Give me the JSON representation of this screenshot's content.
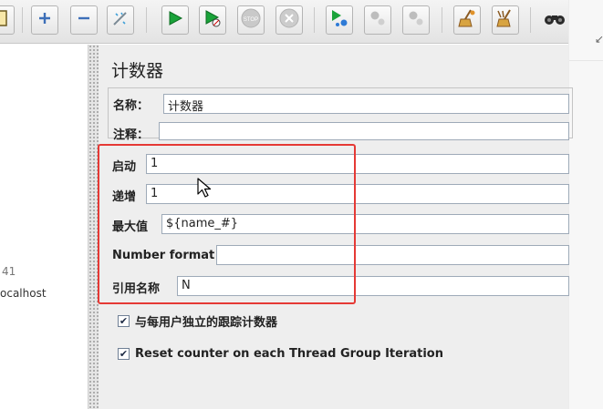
{
  "toolbar": {
    "buttons": [
      {
        "name": "templates-button",
        "icon": "document-icon"
      },
      {
        "name": "expand-all-button",
        "icon": "plus-icon"
      },
      {
        "name": "collapse-all-button",
        "icon": "minus-icon"
      },
      {
        "name": "toggle-button",
        "icon": "wand-icon"
      },
      {
        "name": "start-button",
        "icon": "play-icon"
      },
      {
        "name": "start-no-pauses-button",
        "icon": "play-no-timer-icon"
      },
      {
        "name": "stop-button",
        "icon": "stop-icon"
      },
      {
        "name": "shutdown-button",
        "icon": "shutdown-icon"
      },
      {
        "name": "remote-start-button",
        "icon": "remote-play-icon"
      },
      {
        "name": "remote-stop-button",
        "icon": "remote-stop-icon"
      },
      {
        "name": "remote-shutdown-button",
        "icon": "remote-shutdown-icon"
      },
      {
        "name": "clear-button",
        "icon": "broom-icon"
      },
      {
        "name": "clear-all-button",
        "icon": "broom-all-icon"
      },
      {
        "name": "search-button",
        "icon": "binoculars-icon"
      }
    ],
    "stop_label": "STOP"
  },
  "tree": {
    "partial_number": "41",
    "partial_host": "ocalhost"
  },
  "panel": {
    "title": "计数器",
    "name_label": "名称：",
    "name_value": "计数器",
    "comment_label": "注释：",
    "comment_value": "",
    "start_label": "启动",
    "start_value": "1",
    "increment_label": "递增",
    "increment_value": "1",
    "maximum_label": "最大值",
    "maximum_value": "${name_#}",
    "number_format_label": "Number format",
    "number_format_value": "",
    "reference_name_label": "引用名称",
    "reference_name_value": "N",
    "per_user_label": "与每用户独立的跟踪计数器",
    "per_user_checked": true,
    "reset_label": "Reset counter on each Thread Group Iteration",
    "reset_checked": true
  },
  "colors": {
    "highlight": "#e53935",
    "play": "#1aa33a"
  }
}
